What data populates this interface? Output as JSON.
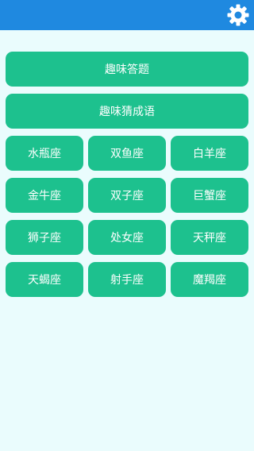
{
  "header": {
    "settings_icon": "gear-icon",
    "bar_color": "#1f89e0"
  },
  "menu": {
    "quiz_label": "趣味答题",
    "idiom_label": "趣味猜成语"
  },
  "zodiac": [
    "水瓶座",
    "双鱼座",
    "白羊座",
    "金牛座",
    "双子座",
    "巨蟹座",
    "狮子座",
    "处女座",
    "天秤座",
    "天蝎座",
    "射手座",
    "魔羯座"
  ],
  "colors": {
    "button": "#1dc18e",
    "background": "#eafcfd"
  }
}
